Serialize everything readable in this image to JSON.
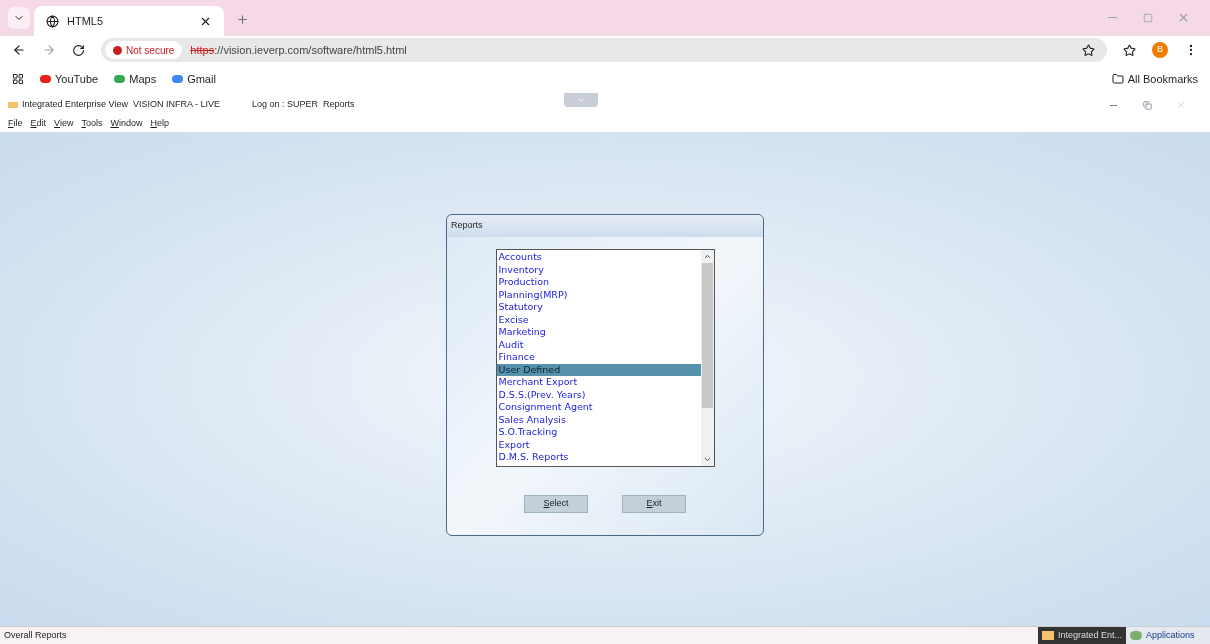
{
  "browser": {
    "tab": {
      "title": "HTML5",
      "selected": true
    },
    "security": "Not secure",
    "url_scheme": "https",
    "url_rest": "://vision.ieverp.com/software/html5.html",
    "profile": "B",
    "bookmarks": [
      "YouTube",
      "Maps",
      "Gmail"
    ],
    "all_bookmarks": "All Bookmarks"
  },
  "app": {
    "title": "Integrated Enterprise View  VISION INFRA - LIVE",
    "logon": "Log on : SUPER  Reports",
    "menu": [
      "File",
      "Edit",
      "View",
      "Tools",
      "Window",
      "Help"
    ]
  },
  "dialog": {
    "title": "Reports",
    "items": [
      {
        "label": "Accounts",
        "selected": false
      },
      {
        "label": "Inventory",
        "selected": false
      },
      {
        "label": "Production",
        "selected": false
      },
      {
        "label": "Planning(MRP)",
        "selected": false
      },
      {
        "label": "Statutory",
        "selected": false
      },
      {
        "label": "Excise",
        "selected": false
      },
      {
        "label": "Marketing",
        "selected": false
      },
      {
        "label": "Audit",
        "selected": false
      },
      {
        "label": "Finance",
        "selected": false
      },
      {
        "label": "User Defined",
        "selected": true
      },
      {
        "label": "Merchant Export",
        "selected": false
      },
      {
        "label": "D.S.S.(Prev. Years)",
        "selected": false
      },
      {
        "label": "Consignment Agent",
        "selected": false
      },
      {
        "label": "Sales Analysis",
        "selected": false
      },
      {
        "label": "S.O.Tracking",
        "selected": false
      },
      {
        "label": "Export",
        "selected": false
      },
      {
        "label": "D.M.S. Reports",
        "selected": false
      }
    ],
    "buttons": [
      "Select",
      "Exit"
    ]
  },
  "status_bar": {
    "text": "Overall Reports",
    "tasks": [
      {
        "label": "Integrated Ent...",
        "selected": true
      },
      {
        "label": "Applications",
        "selected": false
      }
    ]
  }
}
